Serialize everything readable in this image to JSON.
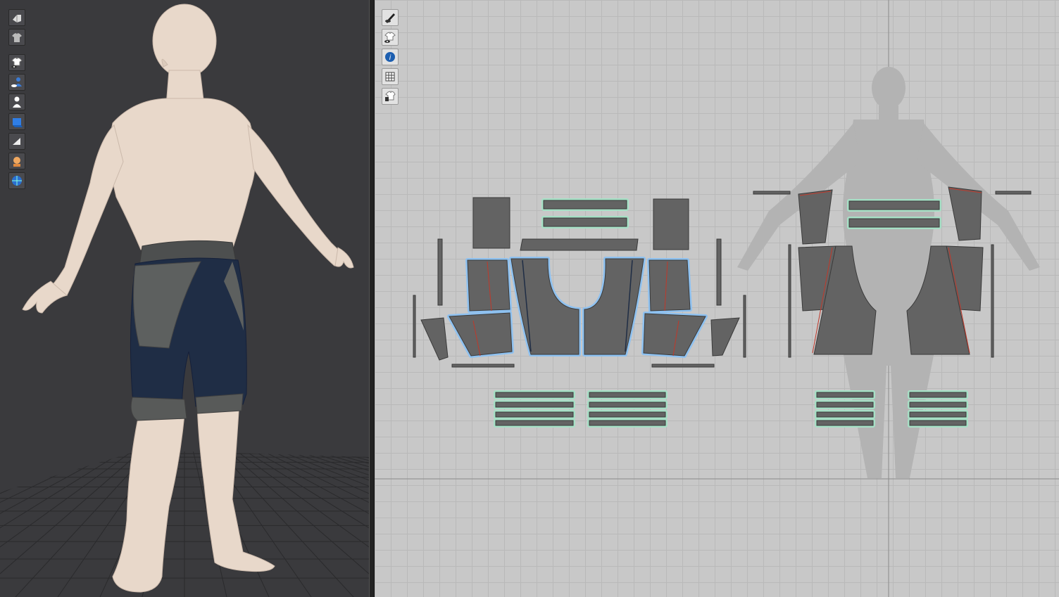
{
  "viewport_3d": {
    "background": "#3a3a3d",
    "toolbar": [
      {
        "icon": "avatar-display-icon"
      },
      {
        "icon": "garment-display-icon"
      },
      {
        "icon": "garment-visibility-icon"
      },
      {
        "icon": "avatar-visibility-icon"
      },
      {
        "icon": "avatar-silhouette-icon"
      },
      {
        "icon": "fabric-texture-icon"
      },
      {
        "icon": "flat-shading-icon"
      },
      {
        "icon": "avatar-head-icon"
      },
      {
        "icon": "environment-globe-icon"
      }
    ],
    "avatar": {
      "skin_color": "#e6d6c8"
    },
    "garment": {
      "type": "shorts",
      "main_color": "#1f2d45",
      "panel_color": "#5a5d5c",
      "waistband_color": "#4d4f4f"
    }
  },
  "viewport_2d": {
    "background": "#c8c8c8",
    "grid_color": "#b9b9b9",
    "toolbar": [
      {
        "icon": "pen-visibility-icon"
      },
      {
        "icon": "garment-visibility-icon"
      },
      {
        "icon": "info-icon"
      },
      {
        "icon": "grid-visibility-icon"
      },
      {
        "icon": "garment-lock-icon"
      }
    ],
    "pattern_color": "#636363",
    "selected_outline_color": "#8ec1f0",
    "binding_outline_color": "#a7e0c6",
    "seam_line_color": "#c0392b"
  }
}
